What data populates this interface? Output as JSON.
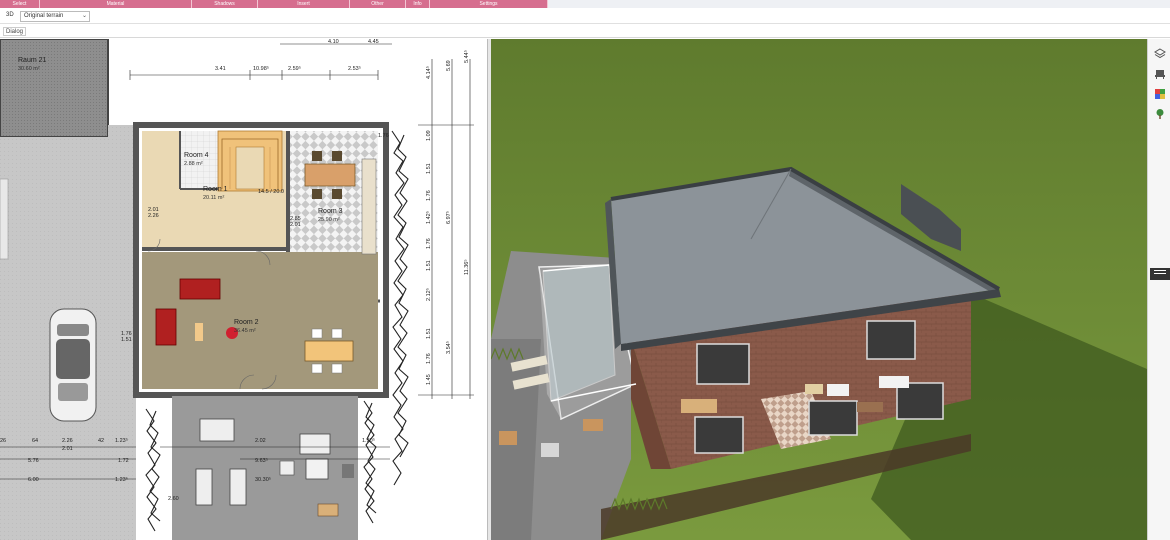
{
  "ribbon": {
    "tabs": [
      "Select",
      "Material",
      "Shadows",
      "Insert",
      "Other",
      "Info",
      "Settings"
    ]
  },
  "toolbar": {
    "view_mode": "3D",
    "terrain_select": "Original terrain",
    "dialog_label": "Dialog"
  },
  "plan": {
    "rooms": [
      {
        "name": "Raum 21",
        "area": "30.60 m²"
      },
      {
        "name": "Room 4",
        "area": "2.88 m²"
      },
      {
        "name": "Room 1",
        "area": "20.11 m²"
      },
      {
        "name": "Room 3",
        "area": "25.90 m²"
      },
      {
        "name": "Room 2",
        "area": "36.45 m²"
      }
    ],
    "dims_top": [
      "3.41",
      "10.98⁵",
      "2.59⁵",
      "2.53⁵",
      "4.10",
      "4.45"
    ],
    "dims_right": [
      "4.14⁵",
      "5.69",
      "5.44⁵",
      "1.09",
      "1.51",
      "1.76",
      "1.42⁵",
      "6.97⁵",
      "11.36⁵",
      "1.76",
      "1.51",
      "2.12⁵",
      "3.54⁵",
      "1.51",
      "1.45",
      "1.76"
    ],
    "dims_bottom": [
      "26",
      "64",
      "2.26",
      "42",
      "1.23⁵",
      "2.01",
      "2.02",
      "1.30⁵",
      "5.76",
      "1.72",
      "6.00",
      "1.23⁵",
      "2.60",
      "9.63⁵",
      "30.30⁵"
    ],
    "dims_misc": [
      "2.01",
      "2.26",
      "1.76",
      "1.51",
      "14.5 / 20.0",
      "2.01",
      "2.85",
      "1.76"
    ]
  },
  "colors": {
    "ribbon_accent": "#d66e8f",
    "grass": "#6f8a3a",
    "floor_wood": "#e9d9b5",
    "floor_room2": "#a3987b"
  },
  "icons": [
    "layers-icon",
    "furniture-icon",
    "materials-icon",
    "tree-icon",
    "menu-icon"
  ]
}
